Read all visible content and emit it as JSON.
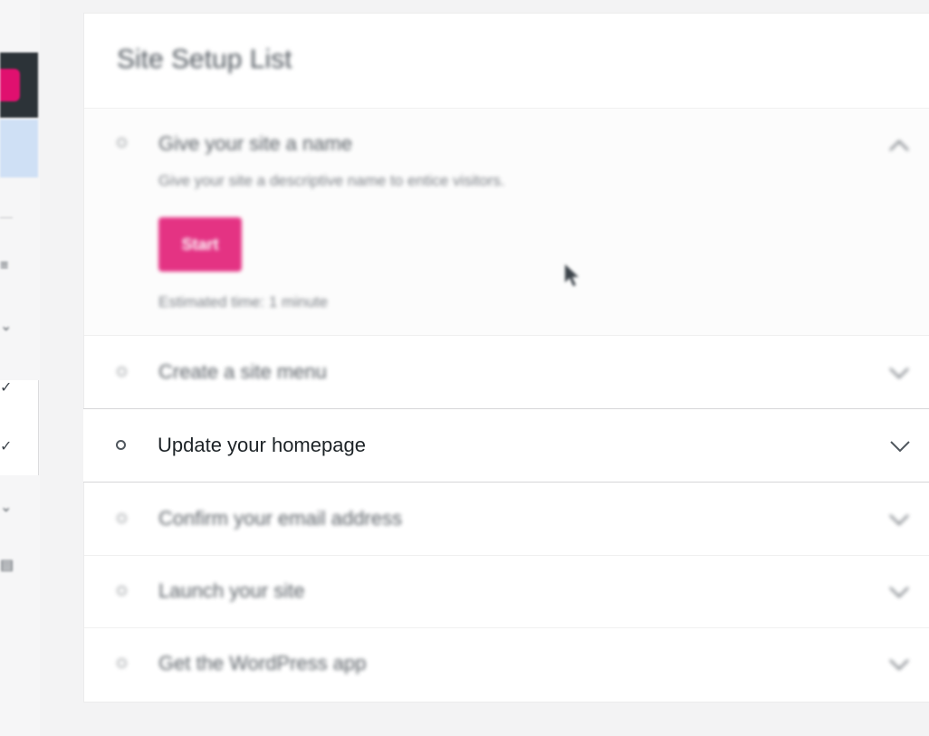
{
  "card": {
    "title": "Site Setup List"
  },
  "tasks": [
    {
      "title": "Give your site a name",
      "description": "Give your site a descriptive name to entice visitors.",
      "button": "Start",
      "estimate": "Estimated time: 1 minute",
      "expanded": true
    },
    {
      "title": "Create a site menu"
    },
    {
      "title": "Update your homepage",
      "highlighted": true
    },
    {
      "title": "Confirm your email address"
    },
    {
      "title": "Launch your site"
    },
    {
      "title": "Get the WordPress app"
    }
  ],
  "colors": {
    "accent": "#e0106f",
    "sidebar_dark": "#2c3338",
    "sidebar_selected": "#cfe0f5"
  },
  "icons": {
    "collapse": "chevron-up-icon",
    "expand": "chevron-down-icon",
    "status": "circle-icon"
  }
}
